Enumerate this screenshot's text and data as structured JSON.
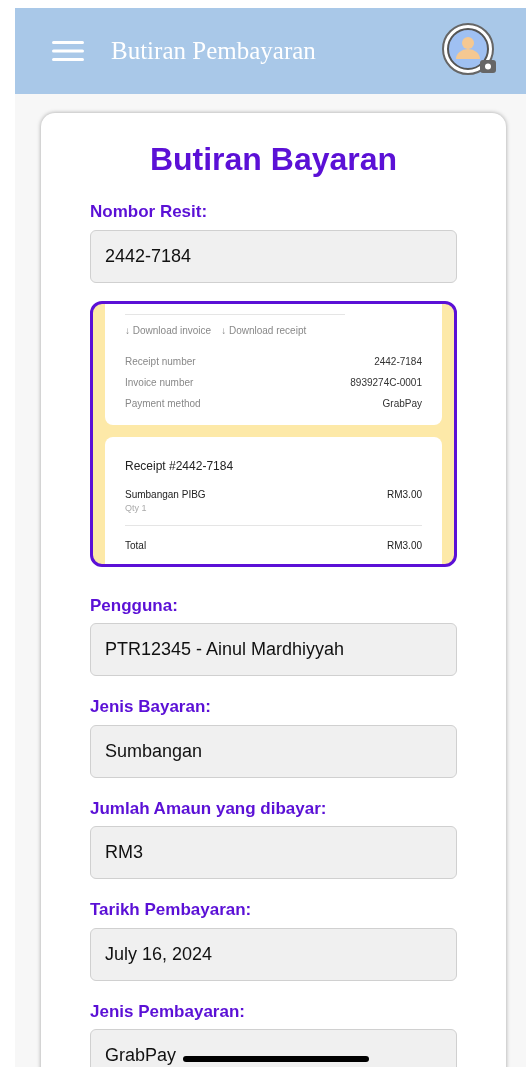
{
  "header": {
    "title": "Butiran Pembayaran"
  },
  "card": {
    "title": "Butiran Bayaran"
  },
  "fields": [
    {
      "kind": "text",
      "label": "Nombor Resit:",
      "value": "2442-7184"
    },
    {
      "kind": "image",
      "receipt": {
        "links": [
          "↓ Download invoice",
          "↓ Download receipt"
        ],
        "details": [
          {
            "name": "Receipt number",
            "value": "2442-7184"
          },
          {
            "name": "Invoice number",
            "value": "8939274C-0001"
          },
          {
            "name": "Payment method",
            "value": "GrabPay"
          }
        ],
        "title": "Receipt #2442-7184",
        "item": {
          "name": "Sumbangan PIBG",
          "qty": "Qty 1",
          "amount": "RM3.00"
        },
        "total": {
          "name": "Total",
          "amount": "RM3.00"
        }
      }
    },
    {
      "kind": "text",
      "label": "Pengguna:",
      "value": "PTR12345 - Ainul Mardhiyyah"
    },
    {
      "kind": "text",
      "label": "Jenis Bayaran:",
      "value": "Sumbangan"
    },
    {
      "kind": "text",
      "label": "Jumlah Amaun yang dibayar:",
      "value": "RM3"
    },
    {
      "kind": "text",
      "label": "Tarikh Pembayaran:",
      "value": "July 16, 2024"
    },
    {
      "kind": "text",
      "label": "Jenis Pembayaran:",
      "value": "GrabPay"
    }
  ]
}
